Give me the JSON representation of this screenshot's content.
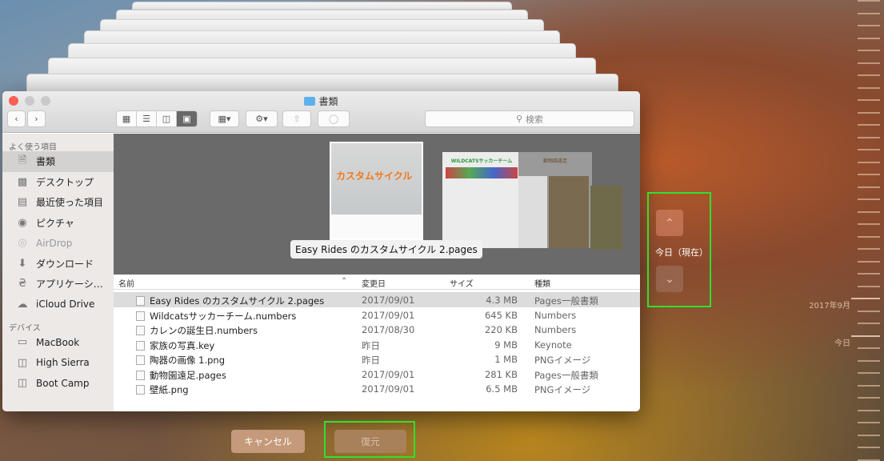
{
  "window": {
    "title": "書類",
    "search_placeholder": "検索"
  },
  "sidebar": {
    "favorites_header": "よく使う項目",
    "favorites": [
      {
        "label": "書類",
        "icon": "documents-icon",
        "selected": true
      },
      {
        "label": "デスクトップ",
        "icon": "desktop-icon"
      },
      {
        "label": "最近使った項目",
        "icon": "recents-icon"
      },
      {
        "label": "ピクチャ",
        "icon": "camera-icon"
      },
      {
        "label": "AirDrop",
        "icon": "airdrop-icon"
      },
      {
        "label": "ダウンロード",
        "icon": "download-icon"
      },
      {
        "label": "アプリケーシ…",
        "icon": "applications-icon"
      },
      {
        "label": "iCloud Drive",
        "icon": "cloud-icon"
      }
    ],
    "devices_header": "デバイス",
    "devices": [
      {
        "label": "MacBook",
        "icon": "laptop-icon"
      },
      {
        "label": "High Sierra",
        "icon": "disk-icon"
      },
      {
        "label": "Boot Camp",
        "icon": "disk-icon"
      }
    ]
  },
  "preview": {
    "caption": "Easy Rides のカスタムサイクル 2.pages",
    "thumb1_text": "カスタムサイクル",
    "thumb2_text": "WILDCATSサッカーチーム",
    "thumb3_text": "動物園遠足"
  },
  "list": {
    "columns": [
      "名前",
      "変更日",
      "サイズ",
      "種類"
    ],
    "rows": [
      [
        "Easy Rides のカスタムサイクル 2.pages",
        "2017/09/01",
        "4.3 MB",
        "Pages一般書類"
      ],
      [
        "Wildcatsサッカーチーム.numbers",
        "2017/09/01",
        "645 KB",
        "Numbers"
      ],
      [
        "カレンの誕生日.numbers",
        "2017/08/30",
        "220 KB",
        "Numbers"
      ],
      [
        "家族の写真.key",
        "昨日",
        "9 MB",
        "Keynote"
      ],
      [
        "陶器の画像 1.png",
        "昨日",
        "1 MB",
        "PNGイメージ"
      ],
      [
        "動物園遠足.pages",
        "2017/09/01",
        "281 KB",
        "Pages一般書類"
      ],
      [
        "壁紙.png",
        "2017/09/01",
        "6.5 MB",
        "PNGイメージ"
      ]
    ]
  },
  "timemachine": {
    "current_label": "今日（現在）",
    "timeline": [
      "2017年9月",
      "今日"
    ],
    "cancel": "キャンセル",
    "restore": "復元"
  },
  "colors": {
    "highlight": "#2fe02f",
    "close": "#fc5f57"
  }
}
